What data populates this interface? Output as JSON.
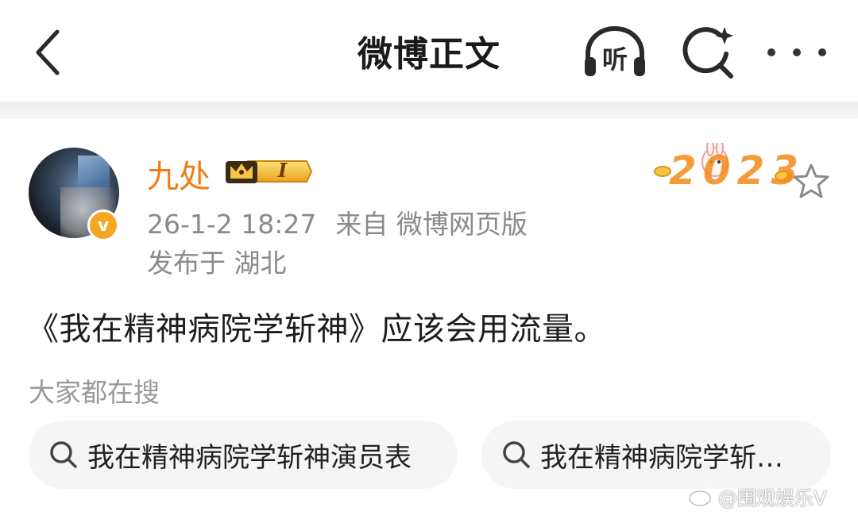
{
  "topbar": {
    "title": "微博正文",
    "listen_label": "听"
  },
  "post": {
    "username": "九处",
    "vip_level": "I",
    "timestamp": "26-1-2 18:27",
    "source": "来自 微博网页版",
    "location": "发布于 湖北",
    "verified_symbol": "v",
    "decoration_text": "2023",
    "text": "《我在精神病院学斩神》应该会用流量。"
  },
  "related_search": {
    "label": "大家都在搜",
    "items": [
      "我在精神病院学斩神演员表",
      "我在精神病院学斩…"
    ]
  },
  "watermark": {
    "text": "@围观娱乐V"
  },
  "colors": {
    "username": "#f07c16",
    "meta_text": "#8a8a8a",
    "chip_bg": "#f5f5f5",
    "badge_gold": "#f5a623"
  },
  "icons": [
    "back-icon",
    "headphone-icon",
    "search-sparkle-icon",
    "more-icon",
    "star-icon",
    "search-icon",
    "weibo-logo-icon"
  ]
}
